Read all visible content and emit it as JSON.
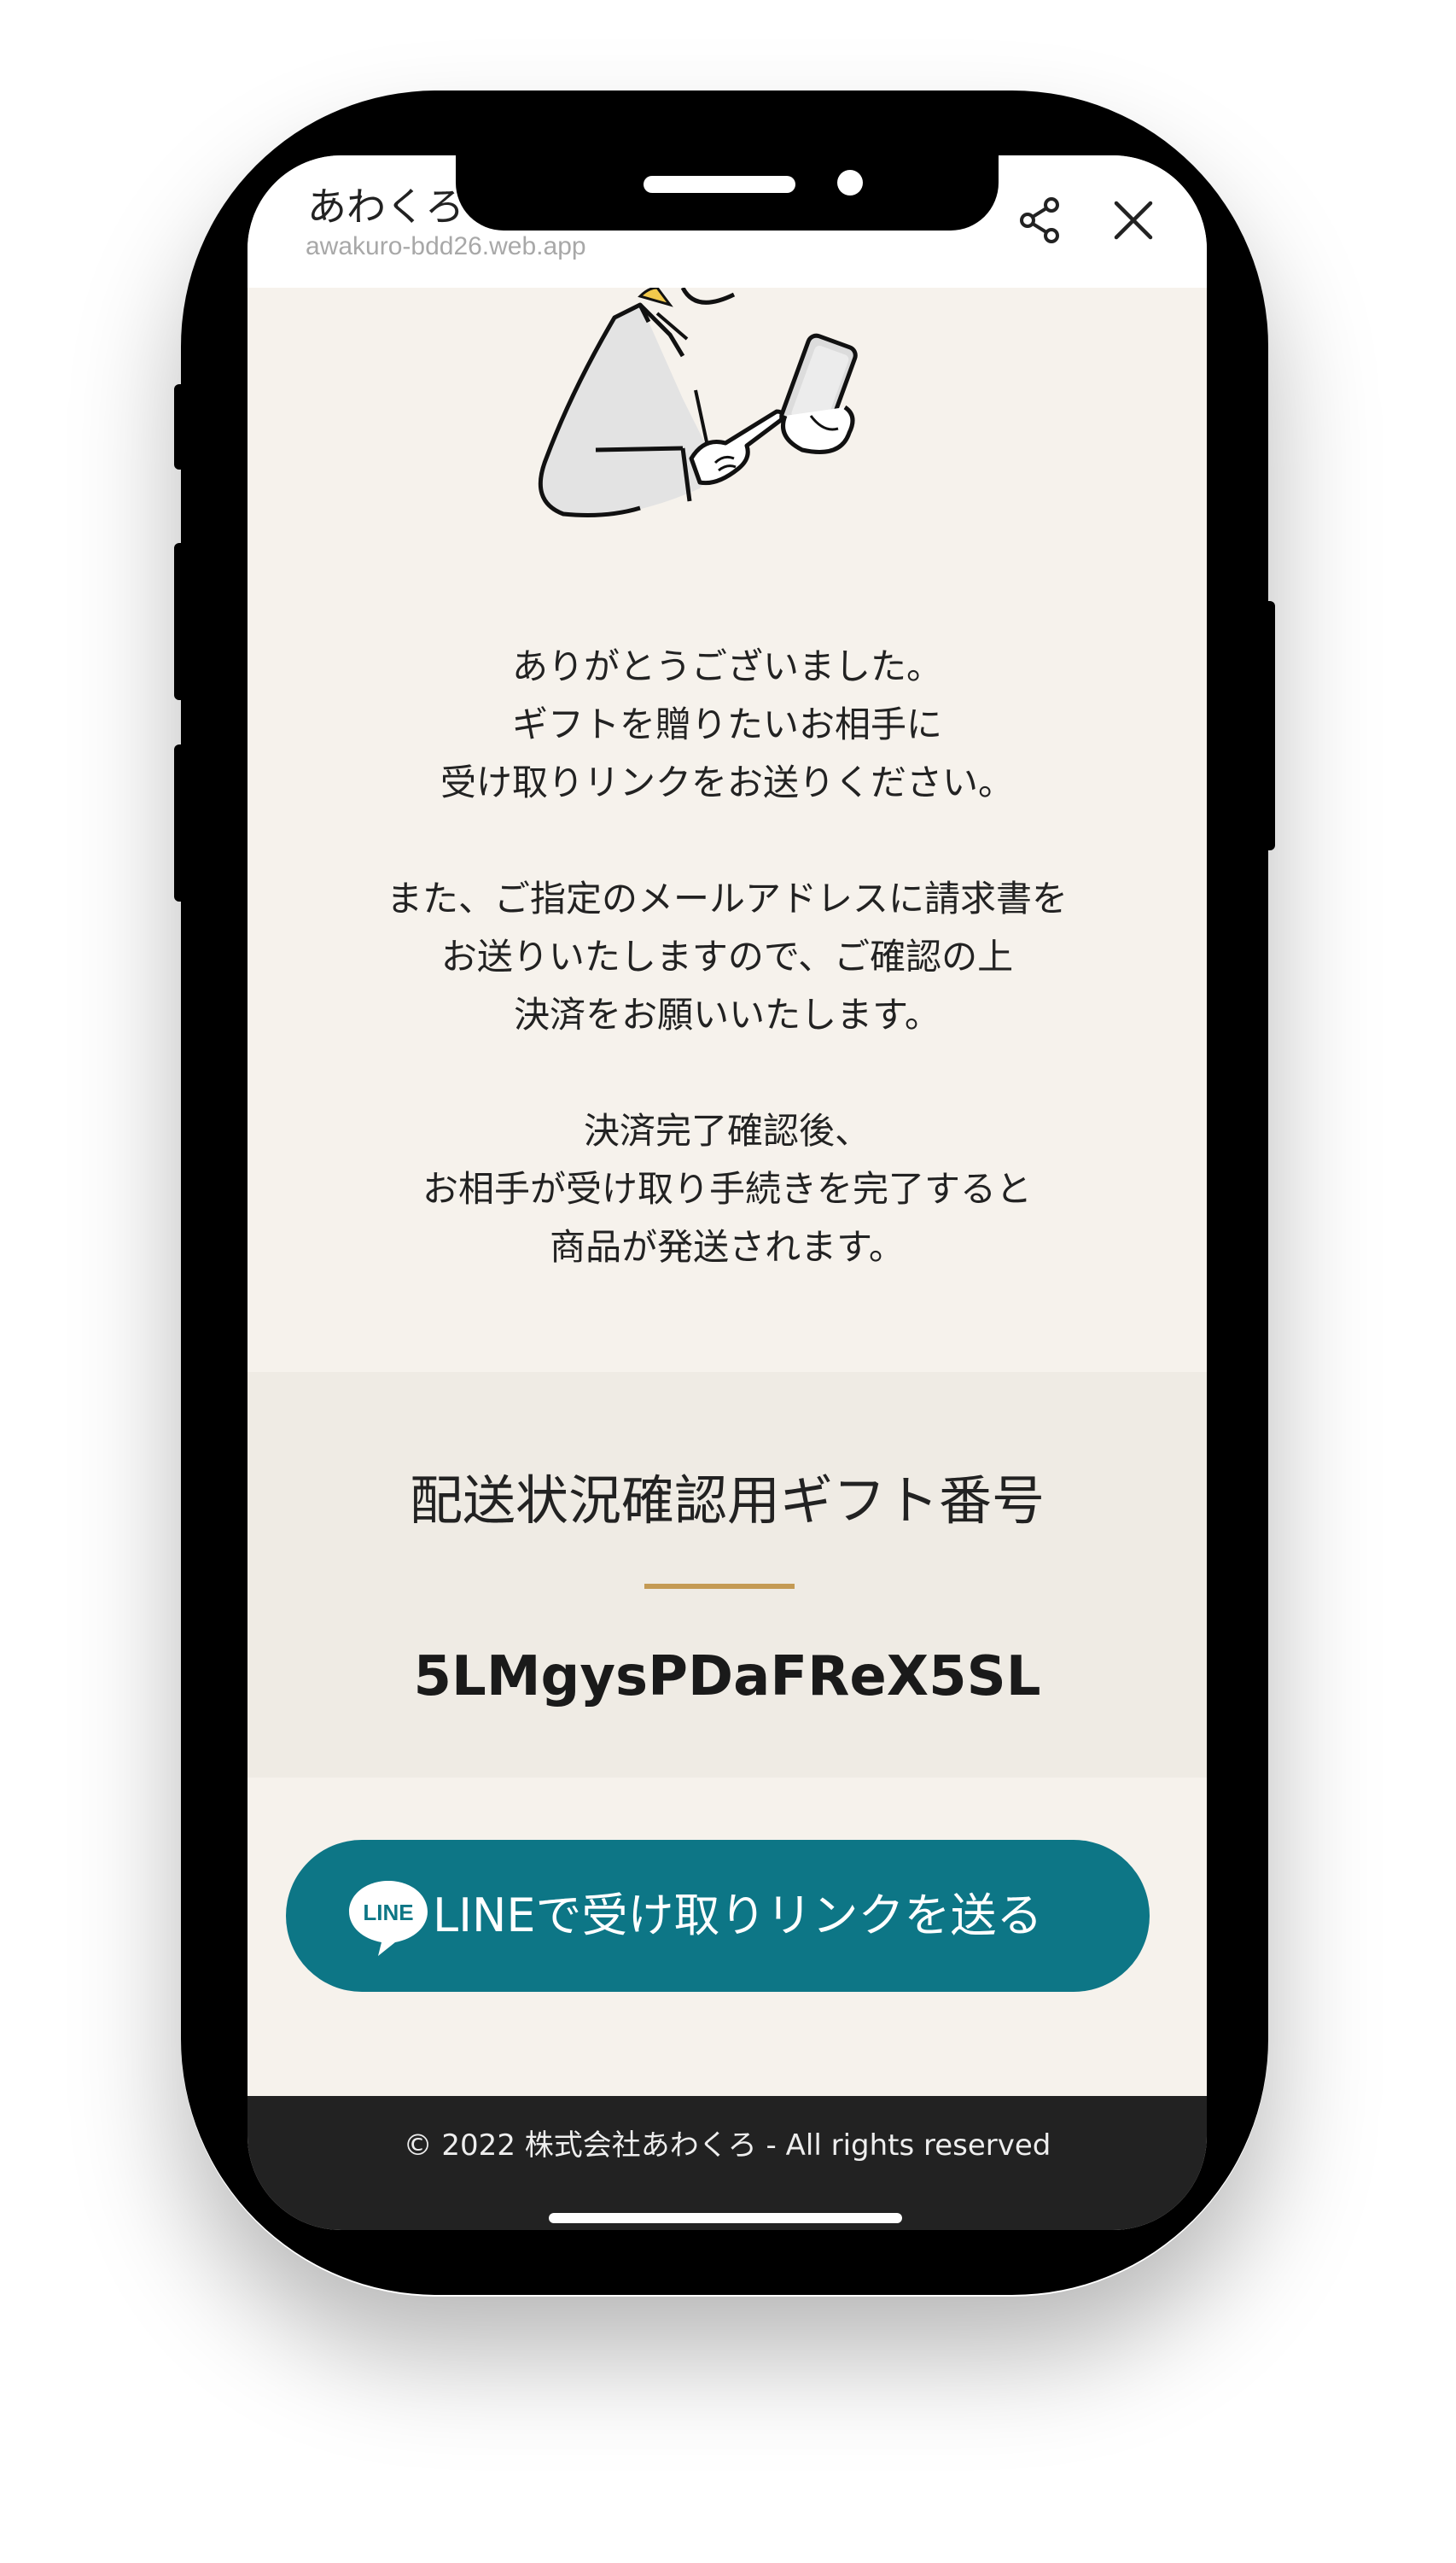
{
  "browser": {
    "site_title": "あわくろ",
    "url": "awakuro-bdd26.web.app"
  },
  "icons": {
    "share": "share-icon",
    "close": "close-icon",
    "line_logo": "line-logo-icon",
    "illustration": "person-with-smartphone-illustration"
  },
  "message": {
    "paragraph1": [
      "ありがとうございました。",
      "ギフトを贈りたいお相手に",
      "受け取りリンクをお送りください。"
    ],
    "paragraph2": [
      "また、ご指定のメールアドレスに請求書を",
      "お送りいたしますので、ご確認の上",
      "決済をお願いいたします。"
    ],
    "paragraph3": [
      "決済完了確認後、",
      "お相手が受け取り手続きを完了すると",
      "商品が発送されます。"
    ]
  },
  "gift": {
    "title": "配送状況確認用ギフト番号",
    "code": "5LMgysPDaFReX5SL"
  },
  "line_button": {
    "logo_text": "LINE",
    "label": "LINEで受け取りリンクを送る"
  },
  "footer": {
    "copyright": "© 2022 株式会社あわくろ - All rights reserved"
  },
  "colors": {
    "background": "#f6f2ec",
    "gift_section": "#efebe4",
    "divider": "#c49a54",
    "line_button": "#0d7686",
    "footer": "#222222"
  }
}
